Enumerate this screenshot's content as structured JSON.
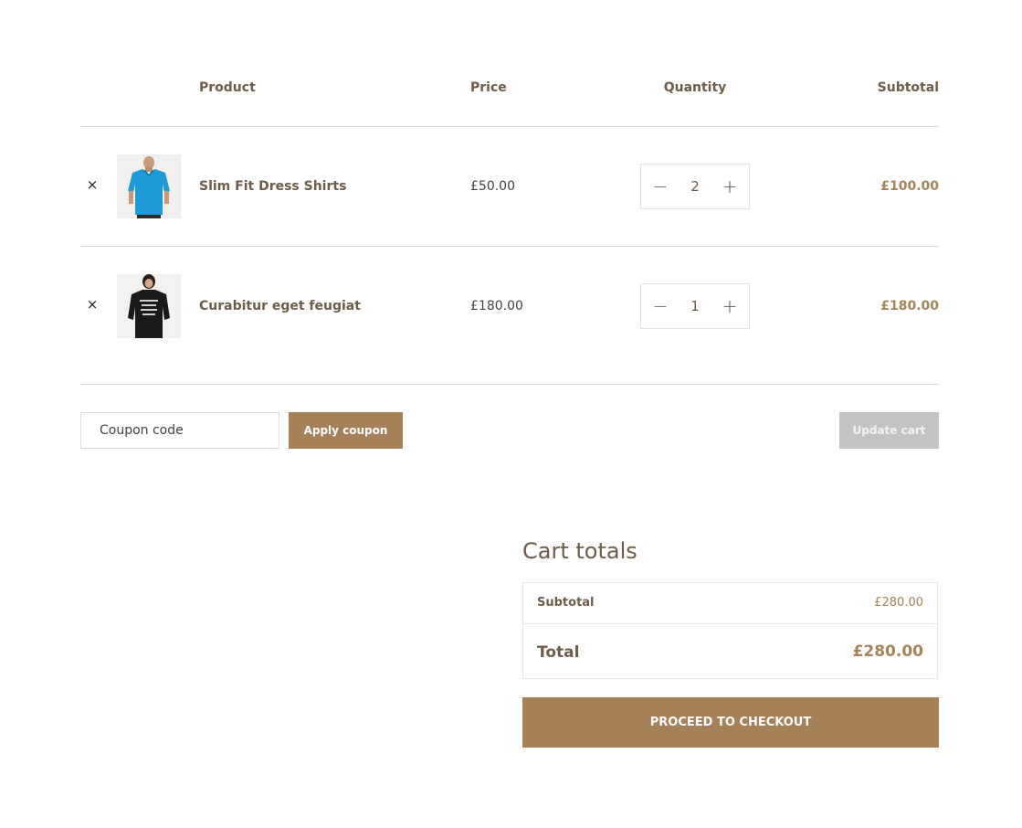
{
  "table": {
    "headers": {
      "product": "Product",
      "price": "Price",
      "quantity": "Quantity",
      "subtotal": "Subtotal"
    },
    "rows": [
      {
        "remove_icon": "×",
        "image": "blue-polo-shirt",
        "name": "Slim Fit Dress Shirts",
        "price": "£50.00",
        "quantity": "2",
        "subtotal": "£100.00"
      },
      {
        "remove_icon": "×",
        "image": "black-sweatshirt",
        "name": "Curabitur eget feugiat",
        "price": "£180.00",
        "quantity": "1",
        "subtotal": "£180.00"
      }
    ]
  },
  "qty_controls": {
    "minus": "−",
    "plus": "+"
  },
  "coupon": {
    "placeholder": "Coupon code",
    "apply_label": "Apply coupon"
  },
  "update_cart_label": "Update cart",
  "totals": {
    "title": "Cart totals",
    "subtotal_label": "Subtotal",
    "subtotal_value": "£280.00",
    "total_label": "Total",
    "total_value": "£280.00"
  },
  "checkout_label": "PROCEED TO CHECKOUT",
  "colors": {
    "accent": "#a58058",
    "text": "#6d5c48",
    "disabled_button": "#c4c4c4"
  }
}
